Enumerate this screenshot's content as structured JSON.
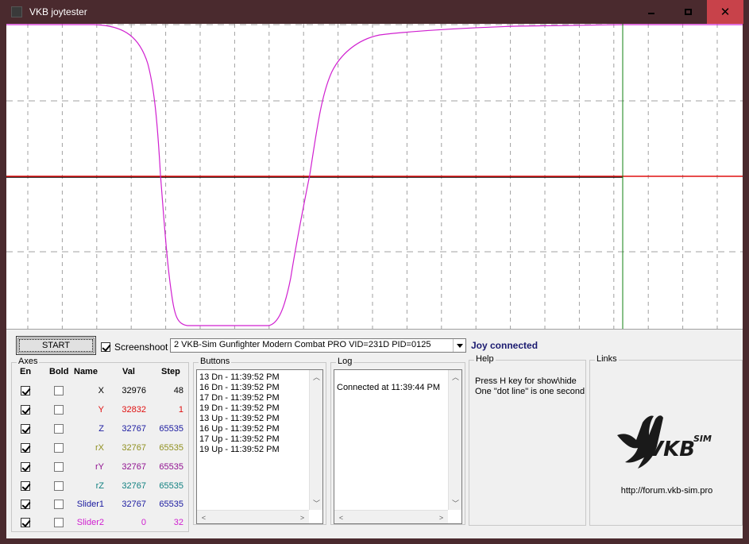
{
  "window": {
    "title": "VKB joytester",
    "close_glyph": "✕"
  },
  "toolbar": {
    "start_label": "START",
    "screenshoot_label": "Screenshoot",
    "screenshoot_checked": true,
    "device_selected": "2  VKB-Sim Gunfighter Modern Combat PRO  VID=231D PID=0125",
    "status": "Joy connected"
  },
  "axes": {
    "title": "Axes",
    "headers": {
      "en": "En",
      "bold": "Bold",
      "name": "Name",
      "val": "Val",
      "step": "Step"
    },
    "rows": [
      {
        "name": "X",
        "val": "32976",
        "step": "48",
        "color": "#000000",
        "enabled": true,
        "bold": false
      },
      {
        "name": "Y",
        "val": "32832",
        "step": "1",
        "color": "#e01010",
        "enabled": true,
        "bold": false
      },
      {
        "name": "Z",
        "val": "32767",
        "step": "65535",
        "color": "#1a1aa0",
        "enabled": true,
        "bold": false
      },
      {
        "name": "rX",
        "val": "32767",
        "step": "65535",
        "color": "#909020",
        "enabled": true,
        "bold": false
      },
      {
        "name": "rY",
        "val": "32767",
        "step": "65535",
        "color": "#901090",
        "enabled": true,
        "bold": false
      },
      {
        "name": "rZ",
        "val": "32767",
        "step": "65535",
        "color": "#108080",
        "enabled": true,
        "bold": false
      },
      {
        "name": "Slider1",
        "val": "32767",
        "step": "65535",
        "color": "#1a1aa0",
        "enabled": true,
        "bold": false
      },
      {
        "name": "Slider2",
        "val": "0",
        "step": "32",
        "color": "#d020d0",
        "enabled": true,
        "bold": false
      }
    ]
  },
  "buttons": {
    "title": "Buttons",
    "events": [
      "13 Dn - 11:39:52 PM",
      "16 Dn - 11:39:52 PM",
      "17 Dn - 11:39:52 PM",
      "19 Dn - 11:39:52 PM",
      "13 Up - 11:39:52 PM",
      "16 Up - 11:39:52 PM",
      "17 Up - 11:39:52 PM",
      "19 Up - 11:39:52 PM"
    ]
  },
  "log": {
    "title": "Log",
    "lines": [
      "Connected at 11:39:44 PM"
    ]
  },
  "help": {
    "title": "Help",
    "lines": [
      "Press H key for show\\hide",
      "One \"dot line\" is one second"
    ]
  },
  "links": {
    "title": "Links",
    "logo_text": "VKB",
    "logo_sup": "SIM",
    "url": "http://forum.vkb-sim.pro"
  },
  "graph": {
    "colors": {
      "grid": "#a0a0a0",
      "x": "#000000",
      "y": "#e01010",
      "slider2": "#d020d0",
      "cursor": "#108010"
    }
  }
}
